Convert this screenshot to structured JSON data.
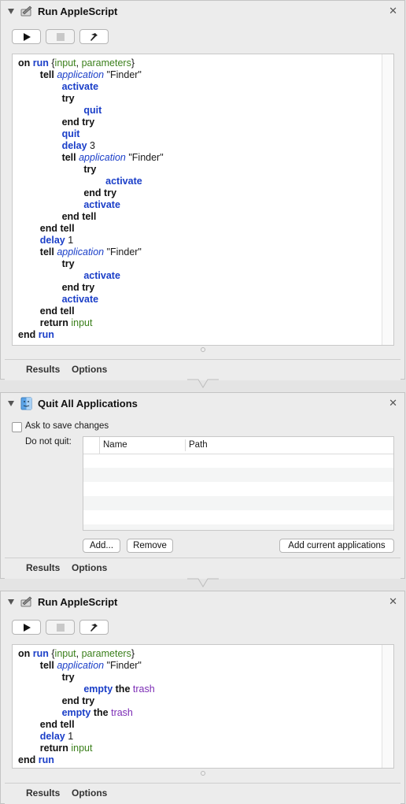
{
  "action1": {
    "title": "Run AppleScript",
    "tabs": [
      "Results",
      "Options"
    ],
    "code": [
      [
        {
          "t": "on ",
          "c": "k"
        },
        {
          "t": "run ",
          "c": "b"
        },
        {
          "t": "{",
          "c": "tx"
        },
        {
          "t": "input",
          "c": "g"
        },
        {
          "t": ", ",
          "c": "tx"
        },
        {
          "t": "parameters",
          "c": "g"
        },
        {
          "t": "}",
          "c": "tx"
        }
      ],
      [
        {
          "t": "        tell ",
          "c": "k"
        },
        {
          "t": "application",
          "c": "ap"
        },
        {
          "t": " \"Finder\"",
          "c": "tx"
        }
      ],
      [
        {
          "t": "                activate",
          "c": "b"
        }
      ],
      [
        {
          "t": "                try",
          "c": "k"
        }
      ],
      [
        {
          "t": "                        quit",
          "c": "b"
        }
      ],
      [
        {
          "t": "                end try",
          "c": "k"
        }
      ],
      [
        {
          "t": "                quit",
          "c": "b"
        }
      ],
      [
        {
          "t": "                delay ",
          "c": "b"
        },
        {
          "t": "3",
          "c": "tx"
        }
      ],
      [
        {
          "t": "                tell ",
          "c": "k"
        },
        {
          "t": "application",
          "c": "ap"
        },
        {
          "t": " \"Finder\"",
          "c": "tx"
        }
      ],
      [
        {
          "t": "                        try",
          "c": "k"
        }
      ],
      [
        {
          "t": "                                activate",
          "c": "b"
        }
      ],
      [
        {
          "t": "                        end try",
          "c": "k"
        }
      ],
      [
        {
          "t": "                        activate",
          "c": "b"
        }
      ],
      [
        {
          "t": "                end tell",
          "c": "k"
        }
      ],
      [
        {
          "t": "        end tell",
          "c": "k"
        }
      ],
      [
        {
          "t": "        delay ",
          "c": "b"
        },
        {
          "t": "1",
          "c": "tx"
        }
      ],
      [
        {
          "t": "        tell ",
          "c": "k"
        },
        {
          "t": "application",
          "c": "ap"
        },
        {
          "t": " \"Finder\"",
          "c": "tx"
        }
      ],
      [
        {
          "t": "                try",
          "c": "k"
        }
      ],
      [
        {
          "t": "                        activate",
          "c": "b"
        }
      ],
      [
        {
          "t": "                end try",
          "c": "k"
        }
      ],
      [
        {
          "t": "                activate",
          "c": "b"
        }
      ],
      [
        {
          "t": "        end tell",
          "c": "k"
        }
      ],
      [
        {
          "t": "        return ",
          "c": "k"
        },
        {
          "t": "input",
          "c": "g"
        }
      ],
      [
        {
          "t": "end ",
          "c": "k"
        },
        {
          "t": "run",
          "c": "b"
        }
      ]
    ]
  },
  "action2": {
    "title": "Quit All Applications",
    "ask_label": "Ask to save changes",
    "ask_checked": false,
    "do_not_quit_label": "Do not quit:",
    "columns": [
      "Name",
      "Path"
    ],
    "add_label": "Add...",
    "remove_label": "Remove",
    "add_current_label": "Add current applications",
    "tabs": [
      "Results",
      "Options"
    ]
  },
  "action3": {
    "title": "Run AppleScript",
    "tabs": [
      "Results",
      "Options"
    ],
    "code": [
      [
        {
          "t": "on ",
          "c": "k"
        },
        {
          "t": "run ",
          "c": "b"
        },
        {
          "t": "{",
          "c": "tx"
        },
        {
          "t": "input",
          "c": "g"
        },
        {
          "t": ", ",
          "c": "tx"
        },
        {
          "t": "parameters",
          "c": "g"
        },
        {
          "t": "}",
          "c": "tx"
        }
      ],
      [
        {
          "t": "        tell ",
          "c": "k"
        },
        {
          "t": "application",
          "c": "ap"
        },
        {
          "t": " \"Finder\"",
          "c": "tx"
        }
      ],
      [
        {
          "t": "                try",
          "c": "k"
        }
      ],
      [
        {
          "t": "                        empty ",
          "c": "b"
        },
        {
          "t": "the ",
          "c": "k"
        },
        {
          "t": "trash",
          "c": "pu"
        }
      ],
      [
        {
          "t": "                end try",
          "c": "k"
        }
      ],
      [
        {
          "t": "                empty ",
          "c": "b"
        },
        {
          "t": "the ",
          "c": "k"
        },
        {
          "t": "trash",
          "c": "pu"
        }
      ],
      [
        {
          "t": "        end tell",
          "c": "k"
        }
      ],
      [
        {
          "t": "        delay ",
          "c": "b"
        },
        {
          "t": "1",
          "c": "tx"
        }
      ],
      [
        {
          "t": "        return ",
          "c": "k"
        },
        {
          "t": "input",
          "c": "g"
        }
      ],
      [
        {
          "t": "end ",
          "c": "k"
        },
        {
          "t": "run",
          "c": "b"
        }
      ]
    ]
  }
}
